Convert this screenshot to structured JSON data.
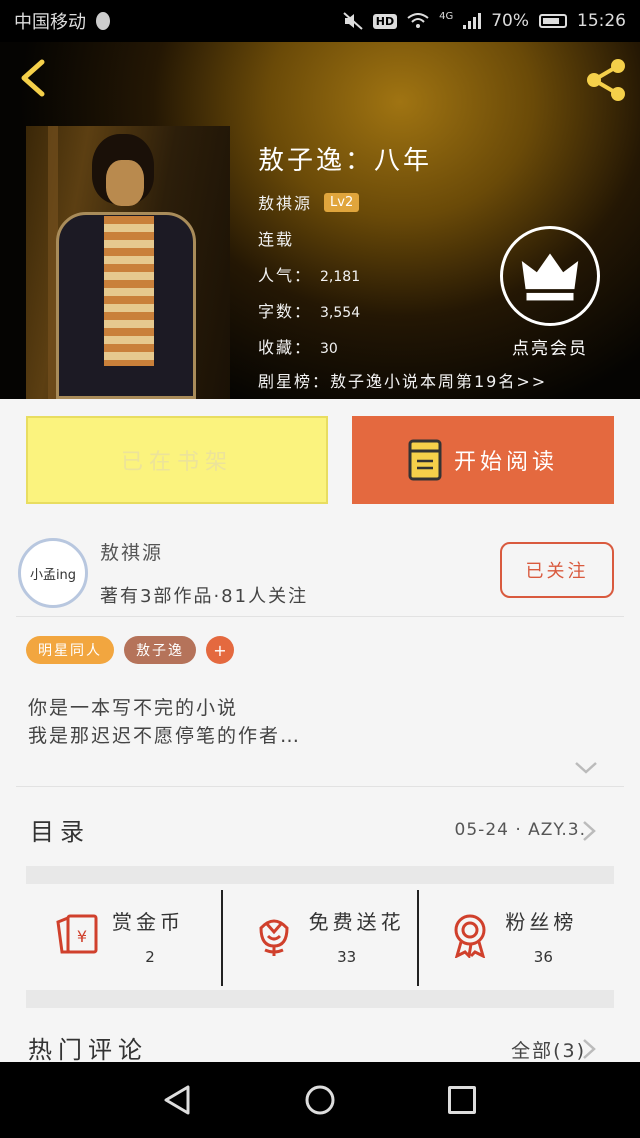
{
  "status_bar": {
    "carrier": "中国移动",
    "hd": "HD",
    "network": "4G",
    "battery": "70%",
    "time": "15:26"
  },
  "book": {
    "title": "敖子逸：八年",
    "author": "敖祺源",
    "level": "Lv2",
    "status": "连载",
    "popularity_label": "人气：",
    "popularity": "2,181",
    "words_label": "字数：",
    "words": "3,554",
    "favorites_label": "收藏：",
    "favorites": "30",
    "rank": "剧星榜：敖子逸小说本周第19名>>"
  },
  "vip": {
    "label": "点亮会员"
  },
  "actions": {
    "shelf": "已在书架",
    "read": "开始阅读"
  },
  "author": {
    "avatar_text": "小孟ing",
    "name": "敖祺源",
    "stats": "著有3部作品·81人关注",
    "follow": "已关注"
  },
  "tags": [
    "明星同人",
    "敖子逸",
    "+"
  ],
  "description": [
    "你是一本写不完的小说",
    "我是那迟迟不愿停笔的作者…"
  ],
  "catalog": {
    "label": "目录",
    "latest": "05-24 · AZY.3."
  },
  "stats": [
    {
      "label": "赏金币",
      "value": "2",
      "icon": "red-envelope-yen-icon"
    },
    {
      "label": "免费送花",
      "value": "33",
      "icon": "flower-icon"
    },
    {
      "label": "粉丝榜",
      "value": "36",
      "icon": "ribbon-medal-icon"
    }
  ],
  "comments": {
    "label": "热门评论",
    "all": "全部(3)"
  },
  "colors": {
    "accent_orange": "#e4693f",
    "shelf_yellow": "#fbf37e",
    "tag_orange": "#f2a63f",
    "tag_brown": "#b5735a",
    "icon_red": "#d0402c",
    "gold": "#f5d04a"
  }
}
